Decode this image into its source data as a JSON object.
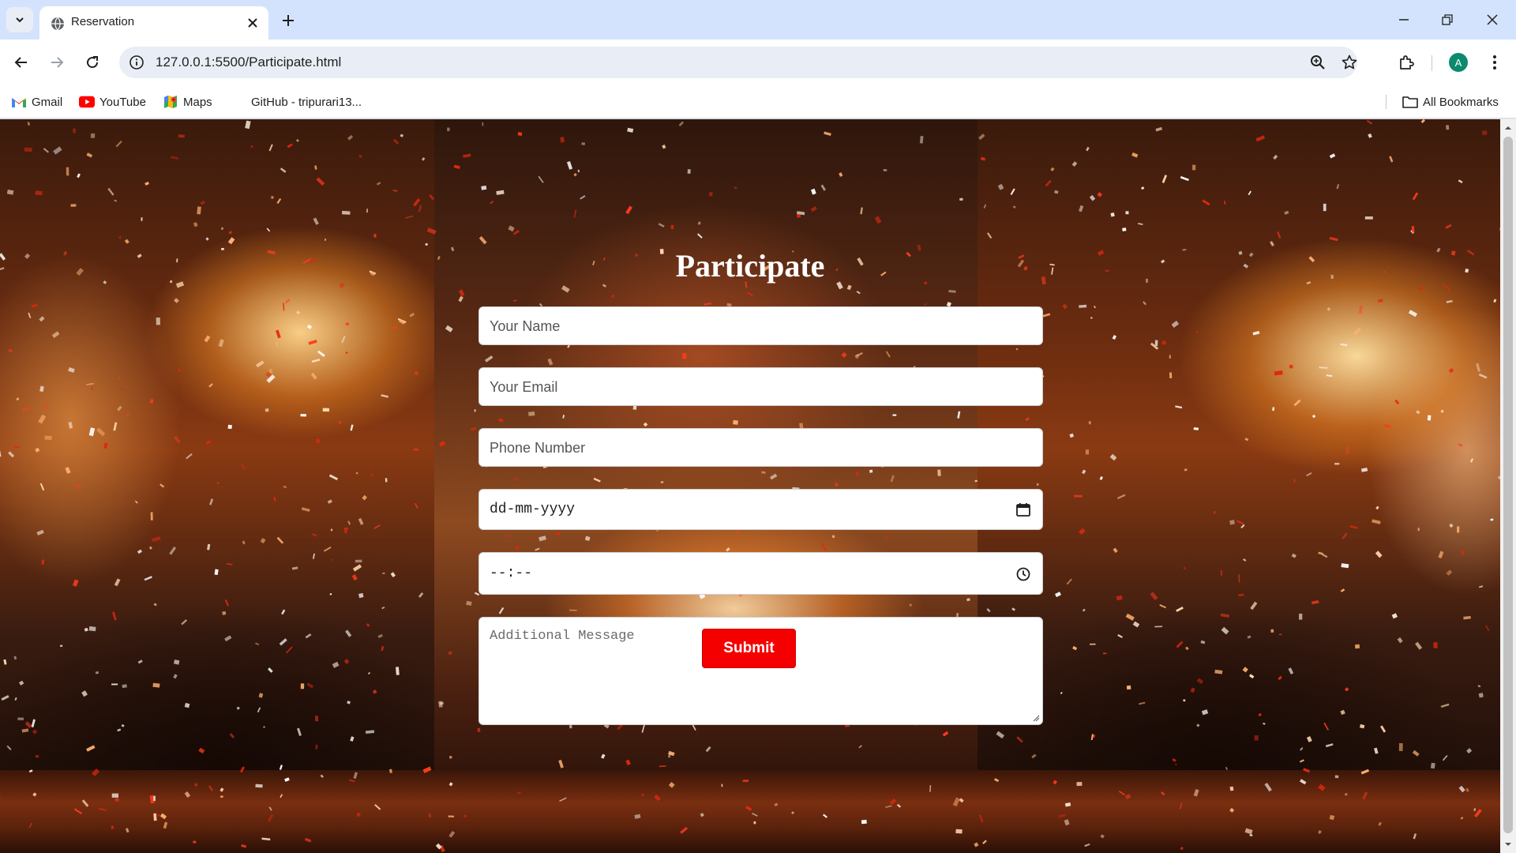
{
  "browser": {
    "tab": {
      "title": "Reservation"
    },
    "address": {
      "url": "127.0.0.1:5500/Participate.html"
    },
    "profile_initial": "A"
  },
  "bookmarks": {
    "items": [
      {
        "label": "Gmail",
        "icon": "gmail-icon"
      },
      {
        "label": "YouTube",
        "icon": "youtube-icon"
      },
      {
        "label": "Maps",
        "icon": "maps-icon"
      },
      {
        "label": "GitHub - tripurari13...",
        "icon": ""
      }
    ],
    "all_label": "All Bookmarks"
  },
  "page": {
    "title": "Participate",
    "form": {
      "name_placeholder": "Your Name",
      "email_placeholder": "Your Email",
      "phone_placeholder": "Phone Number",
      "date_placeholder": "dd-mm-yyyy",
      "time_placeholder": "--:--",
      "message_placeholder": "Additional Message",
      "submit_label": "Submit"
    }
  },
  "colors": {
    "submit_bg": "#f40000",
    "title_text": "#ffffff",
    "tabstrip_bg": "#d3e3fd",
    "avatar_bg": "#0b8a6d"
  }
}
